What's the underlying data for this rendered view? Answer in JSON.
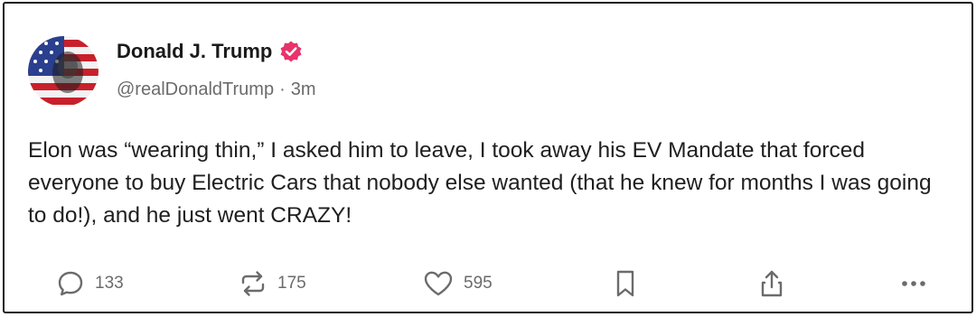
{
  "post": {
    "author": {
      "display_name": "Donald J. Trump",
      "handle": "@realDonaldTrump",
      "separator": "·",
      "time_ago": "3m",
      "avatar_icon": "flag-portrait-avatar",
      "verified_icon": "verified-badge-icon",
      "verified_color": "#e8336b"
    },
    "text": "Elon was “wearing thin,” I asked him to leave, I took away his EV Mandate that forced everyone to buy Electric Cars that nobody else wanted (that he knew for months I was going to do!), and he just went CRAZY!",
    "actions": {
      "reply": {
        "icon": "reply-bubble-icon",
        "count": "133"
      },
      "repost": {
        "icon": "repost-arrows-icon",
        "count": "175"
      },
      "like": {
        "icon": "heart-icon",
        "count": "595"
      },
      "bookmark": {
        "icon": "bookmark-icon"
      },
      "share": {
        "icon": "share-upload-icon"
      },
      "more": {
        "icon": "more-dots-icon"
      }
    },
    "icon_color": "#6b6b6b"
  }
}
